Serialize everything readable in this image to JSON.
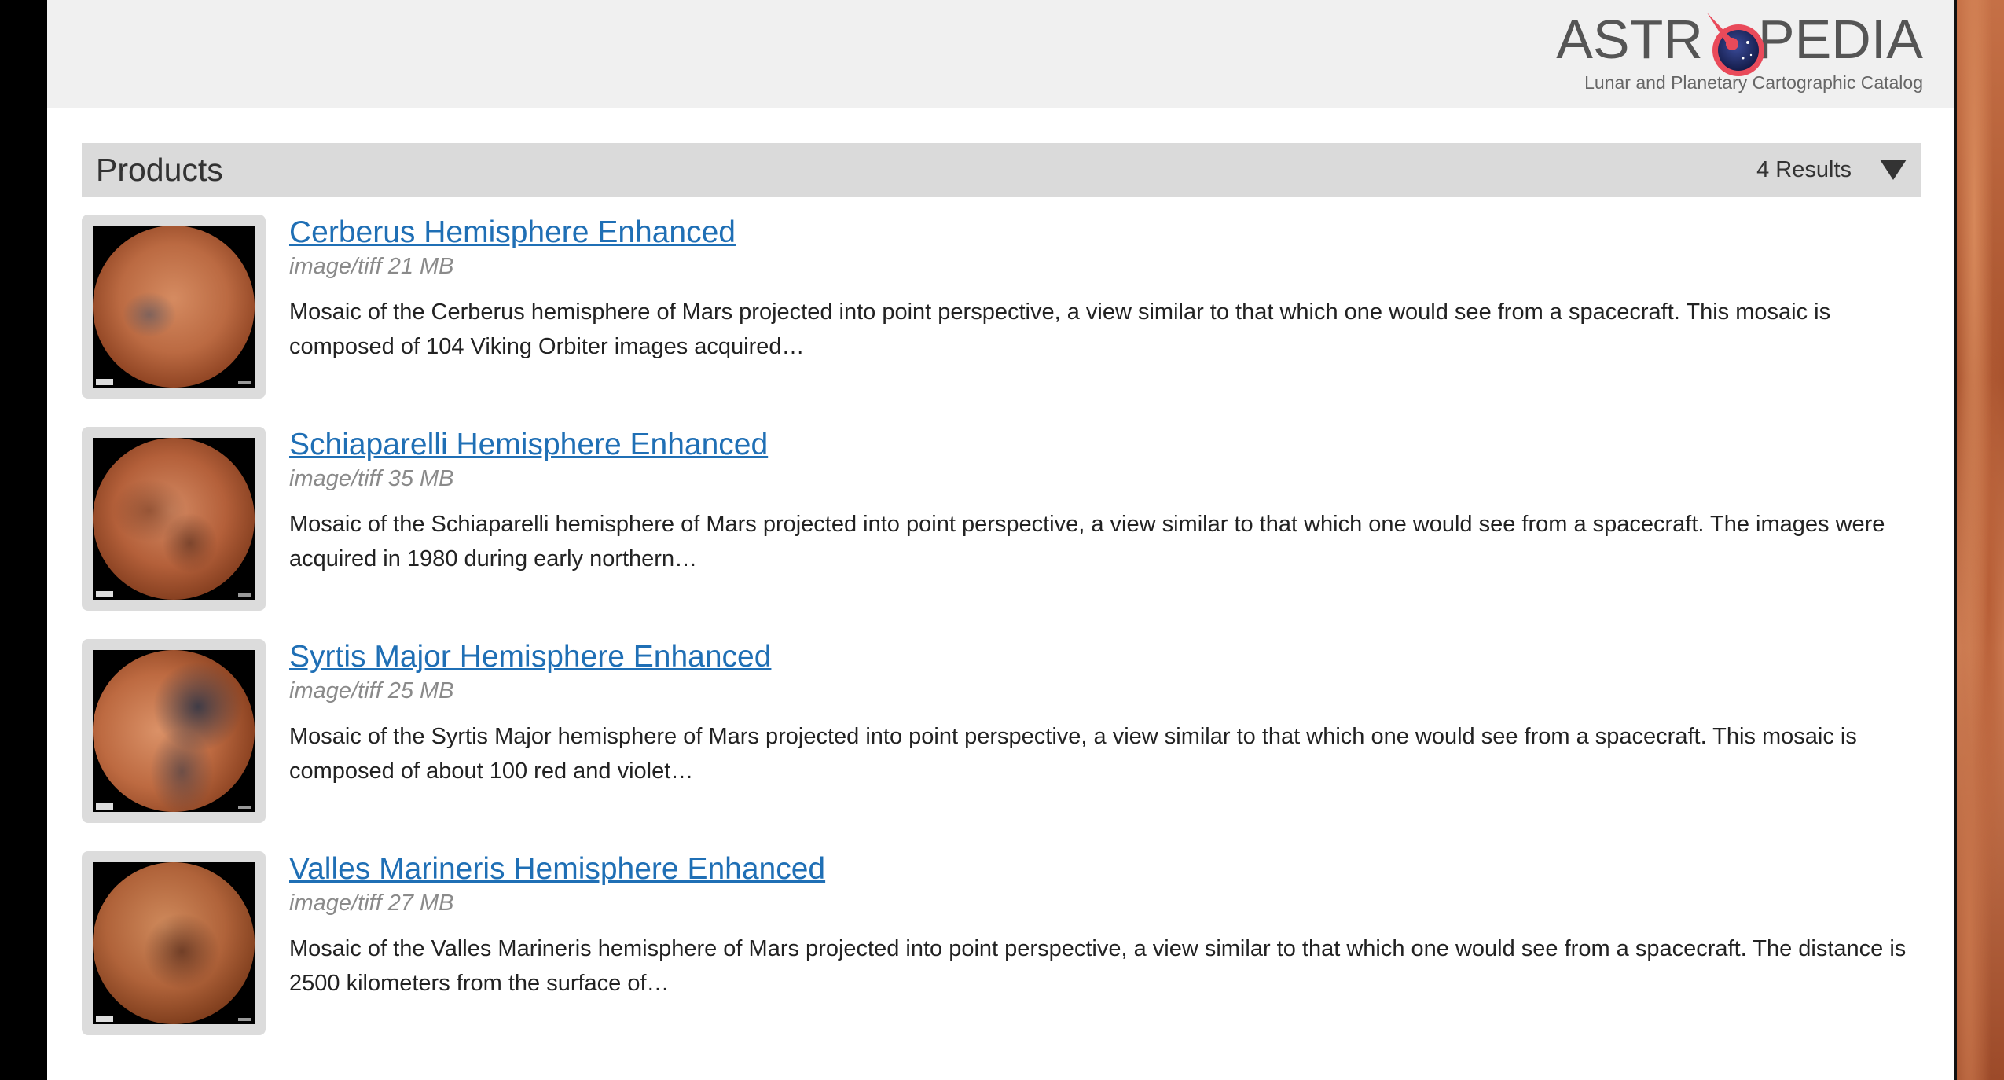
{
  "header": {
    "logo_text_left": "ASTR",
    "logo_text_right": "PEDIA",
    "tagline": "Lunar and Planetary Cartographic Catalog"
  },
  "products": {
    "title": "Products",
    "results_count": "4 Results",
    "toggle_icon": "triangle-down-icon"
  },
  "results": [
    {
      "title": "Cerberus Hemisphere Enhanced",
      "meta": "image/tiff 21 MB",
      "description": "Mosaic of the Cerberus hemisphere of Mars projected into point perspective, a view similar to that which one would see from a spacecraft. This mosaic is composed of 104 Viking Orbiter images acquired…"
    },
    {
      "title": "Schiaparelli Hemisphere Enhanced",
      "meta": "image/tiff 35 MB",
      "description": "Mosaic of the Schiaparelli hemisphere of Mars projected into point perspective, a view similar to that which one would see from a spacecraft. The images were acquired in 1980 during early northern…"
    },
    {
      "title": "Syrtis Major Hemisphere Enhanced",
      "meta": "image/tiff 25 MB",
      "description": "Mosaic of the Syrtis Major hemisphere of Mars projected into point perspective, a view similar to that which one would see from a spacecraft. This mosaic is composed of about 100 red and violet…"
    },
    {
      "title": "Valles Marineris Hemisphere Enhanced",
      "meta": "image/tiff 27 MB",
      "description": "Mosaic of the Valles Marineris hemisphere of Mars projected into point perspective, a view similar to that which one would see from a spacecraft. The distance is 2500 kilometers from the surface of…"
    }
  ],
  "colors": {
    "link": "#1f6fb5",
    "header_bg": "#f0f0f0",
    "bar_bg": "#dadada"
  }
}
